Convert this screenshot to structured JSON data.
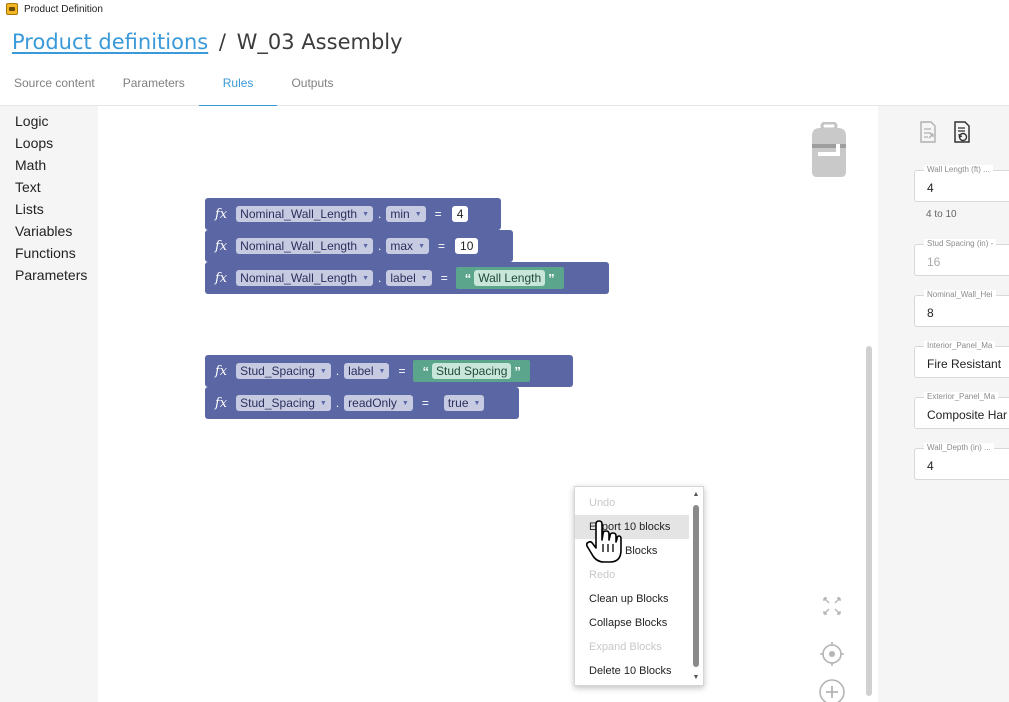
{
  "window": {
    "title": "Product Definition"
  },
  "breadcrumb": {
    "link": "Product definitions",
    "separator": "/",
    "current": "W_03 Assembly"
  },
  "tabs": [
    {
      "label": "Source content",
      "active": false
    },
    {
      "label": "Parameters",
      "active": false
    },
    {
      "label": "Rules",
      "active": true
    },
    {
      "label": "Outputs",
      "active": false
    }
  ],
  "toolbox": {
    "categories": [
      "Logic",
      "Loops",
      "Math",
      "Text",
      "Lists",
      "Variables",
      "Functions",
      "Parameters"
    ]
  },
  "blocks": {
    "fx_symbol": "fx",
    "group1": [
      {
        "param": "Nominal_Wall_Length",
        "property": "min",
        "value": "4"
      },
      {
        "param": "Nominal_Wall_Length",
        "property": "max",
        "value": "10"
      },
      {
        "param": "Nominal_Wall_Length",
        "property": "label",
        "value": "Wall Length"
      }
    ],
    "group2": [
      {
        "param": "Stud_Spacing",
        "property": "label",
        "value": "Stud Spacing"
      },
      {
        "param": "Stud_Spacing",
        "property": "readOnly",
        "value": "true"
      }
    ],
    "eq_symbol": "=",
    "dot_symbol": "."
  },
  "context_menu": {
    "items": [
      {
        "label": "Undo",
        "disabled": true
      },
      {
        "label": "Export 10 blocks",
        "disabled": false,
        "hover": true
      },
      {
        "label": "Blocks",
        "disabled": false
      },
      {
        "label": "Redo",
        "disabled": true
      },
      {
        "label": "Clean up Blocks",
        "disabled": false
      },
      {
        "label": "Collapse Blocks",
        "disabled": false
      },
      {
        "label": "Expand Blocks",
        "disabled": true
      },
      {
        "label": "Delete 10 Blocks",
        "disabled": false
      }
    ]
  },
  "panel": {
    "fields": [
      {
        "label": "Wall Length (ft) ...",
        "value": "4",
        "hint": "4 to 10",
        "disabled": false
      },
      {
        "label": "Stud Spacing (in) -",
        "value": "16",
        "hint": "",
        "disabled": true
      },
      {
        "label": "Nominal_Wall_Hei",
        "value": "8",
        "hint": "",
        "disabled": false
      },
      {
        "label": "Interior_Panel_Ma",
        "value": "Fire Resistant",
        "hint": "",
        "disabled": false
      },
      {
        "label": "Exterior_Panel_Ma",
        "value": "Composite Har",
        "hint": "",
        "disabled": false
      },
      {
        "label": "Wall_Depth (in) ...",
        "value": "4",
        "hint": "",
        "disabled": false
      }
    ]
  },
  "colors": {
    "accent": "#3a9ad9",
    "block_parameter": "#5b67a5",
    "block_text": "#5ba58c",
    "panel_bg": "#f5f5f5"
  },
  "icons": [
    "app-icon",
    "trash-icon",
    "fit-screen-icon",
    "recenter-icon",
    "zoom-in-icon",
    "export-rules-icon",
    "reset-rules-icon",
    "hand-cursor-icon"
  ]
}
